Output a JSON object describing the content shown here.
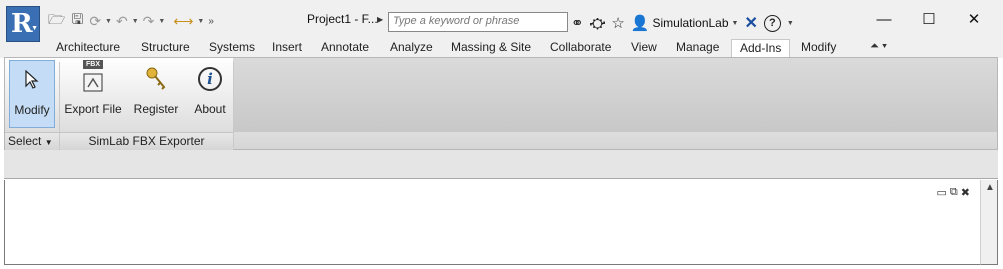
{
  "app": {
    "logo_letter": "R",
    "document_title": "Project1 - F...",
    "search": {
      "placeholder": "Type a keyword or phrase"
    },
    "user_name": "SimulationLab"
  },
  "quick_access": [
    "open-folder-icon",
    "save-icon",
    "sync-icon",
    "undo-icon",
    "redo-icon",
    "measure-icon",
    "overflow-icon"
  ],
  "infocenter_icons": [
    "binoculars-icon",
    "satellite-icon",
    "star-icon",
    "user-icon",
    "exchange-icon",
    "help-icon"
  ],
  "window_controls": {
    "minimize": "—",
    "maximize": "☐",
    "close": "✕"
  },
  "tabs": [
    {
      "label": "Architecture",
      "active": false
    },
    {
      "label": "Structure",
      "active": false
    },
    {
      "label": "Systems",
      "active": false
    },
    {
      "label": "Insert",
      "active": false
    },
    {
      "label": "Annotate",
      "active": false
    },
    {
      "label": "Analyze",
      "active": false
    },
    {
      "label": "Massing & Site",
      "active": false
    },
    {
      "label": "Collaborate",
      "active": false
    },
    {
      "label": "View",
      "active": false
    },
    {
      "label": "Manage",
      "active": false
    },
    {
      "label": "Add-Ins",
      "active": true
    },
    {
      "label": "Modify",
      "active": false
    }
  ],
  "ribbon": {
    "select_panel": {
      "title": "Select",
      "buttons": [
        {
          "label": "Modify",
          "icon": "cursor-arrow-icon",
          "selected": true
        }
      ]
    },
    "simlab_panel": {
      "title": "SimLab FBX Exporter",
      "buttons": [
        {
          "label": "Export File",
          "icon": "fbx-export-icon",
          "badge": "FBX"
        },
        {
          "label": "Register",
          "icon": "keys-icon"
        },
        {
          "label": "About",
          "icon": "about-info-icon",
          "glyph": "i"
        }
      ]
    }
  },
  "colors": {
    "logo_bg": "#3a6fb3",
    "selected_button": "#c4dcf5",
    "accent_blue": "#1a4fa0"
  }
}
